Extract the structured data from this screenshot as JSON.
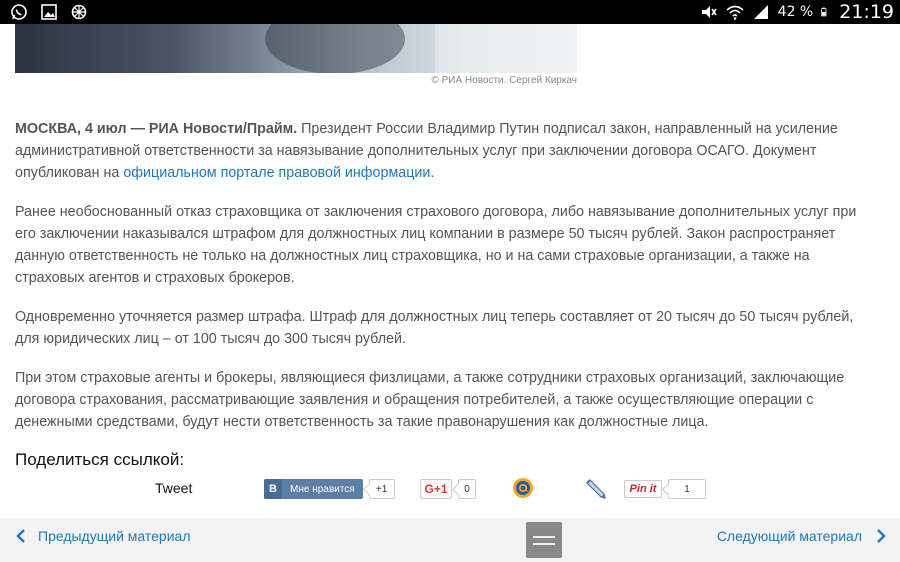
{
  "status_bar": {
    "icons_left": [
      "whatsapp-icon",
      "gallery-icon",
      "settings-icon"
    ],
    "icons_right": [
      "mute-icon",
      "wifi-icon",
      "signal-icon"
    ],
    "battery": "42 %",
    "time": "21:19"
  },
  "hero": {
    "caption": "© РИА Новости. Сергей Киркач"
  },
  "article": {
    "lead_bold": "МОСКВА, 4 июл — РИА Новости/Прайм.",
    "p1_text": " Президент России Владимир Путин подписал закон, направленный на усиление административной ответственности за навязывание дополнительных услуг при заключении договора ОСАГО. Документ опубликован на ",
    "p1_link": "официальном портале правовой информации",
    "p1_end": ".",
    "p2": "Ранее необоснованный отказ страховщика от заключения страхового договора, либо навязывание дополнительных услуг при его заключении наказывался штрафом для должностных лиц компании в размере 50 тысяч рублей. Закон распространяет данную ответственность не только на должностных лиц страховщика, но и на сами страховые организации, а также на страховых агентов и страховых брокеров.",
    "p3": "Одновременно уточняется размер штрафа. Штраф для должностных лиц теперь составляет от 20 тысяч до 50 тысяч рублей, для юридических лиц – от 100 тысяч до 300 тысяч рублей.",
    "p4": "При этом страховые агенты и брокеры, являющиеся физлицами, а также сотрудники страховых организаций, заключающие договора страхования, рассматривающие заявления и обращения потребителей, а также осуществляющие операции с денежными средствами, будут нести ответственность за такие правонарушения как должностные лица."
  },
  "share": {
    "title": "Поделиться ссылкой:",
    "tweet": "Tweet",
    "vk_logo": "В",
    "vk_label": "Мне нравится",
    "vk_count": "+1",
    "gplus_label": "G+1",
    "gplus_count": "0",
    "pin_label": "Pin it",
    "pin_count": "1"
  },
  "nav": {
    "prev": "Предыдущий материал",
    "next": "Следующий материал"
  },
  "colors": {
    "link": "#2278b5",
    "text": "#555555",
    "vk": "#5b7fa6",
    "pinterest": "#cb2027",
    "gplus": "#d73d32"
  }
}
